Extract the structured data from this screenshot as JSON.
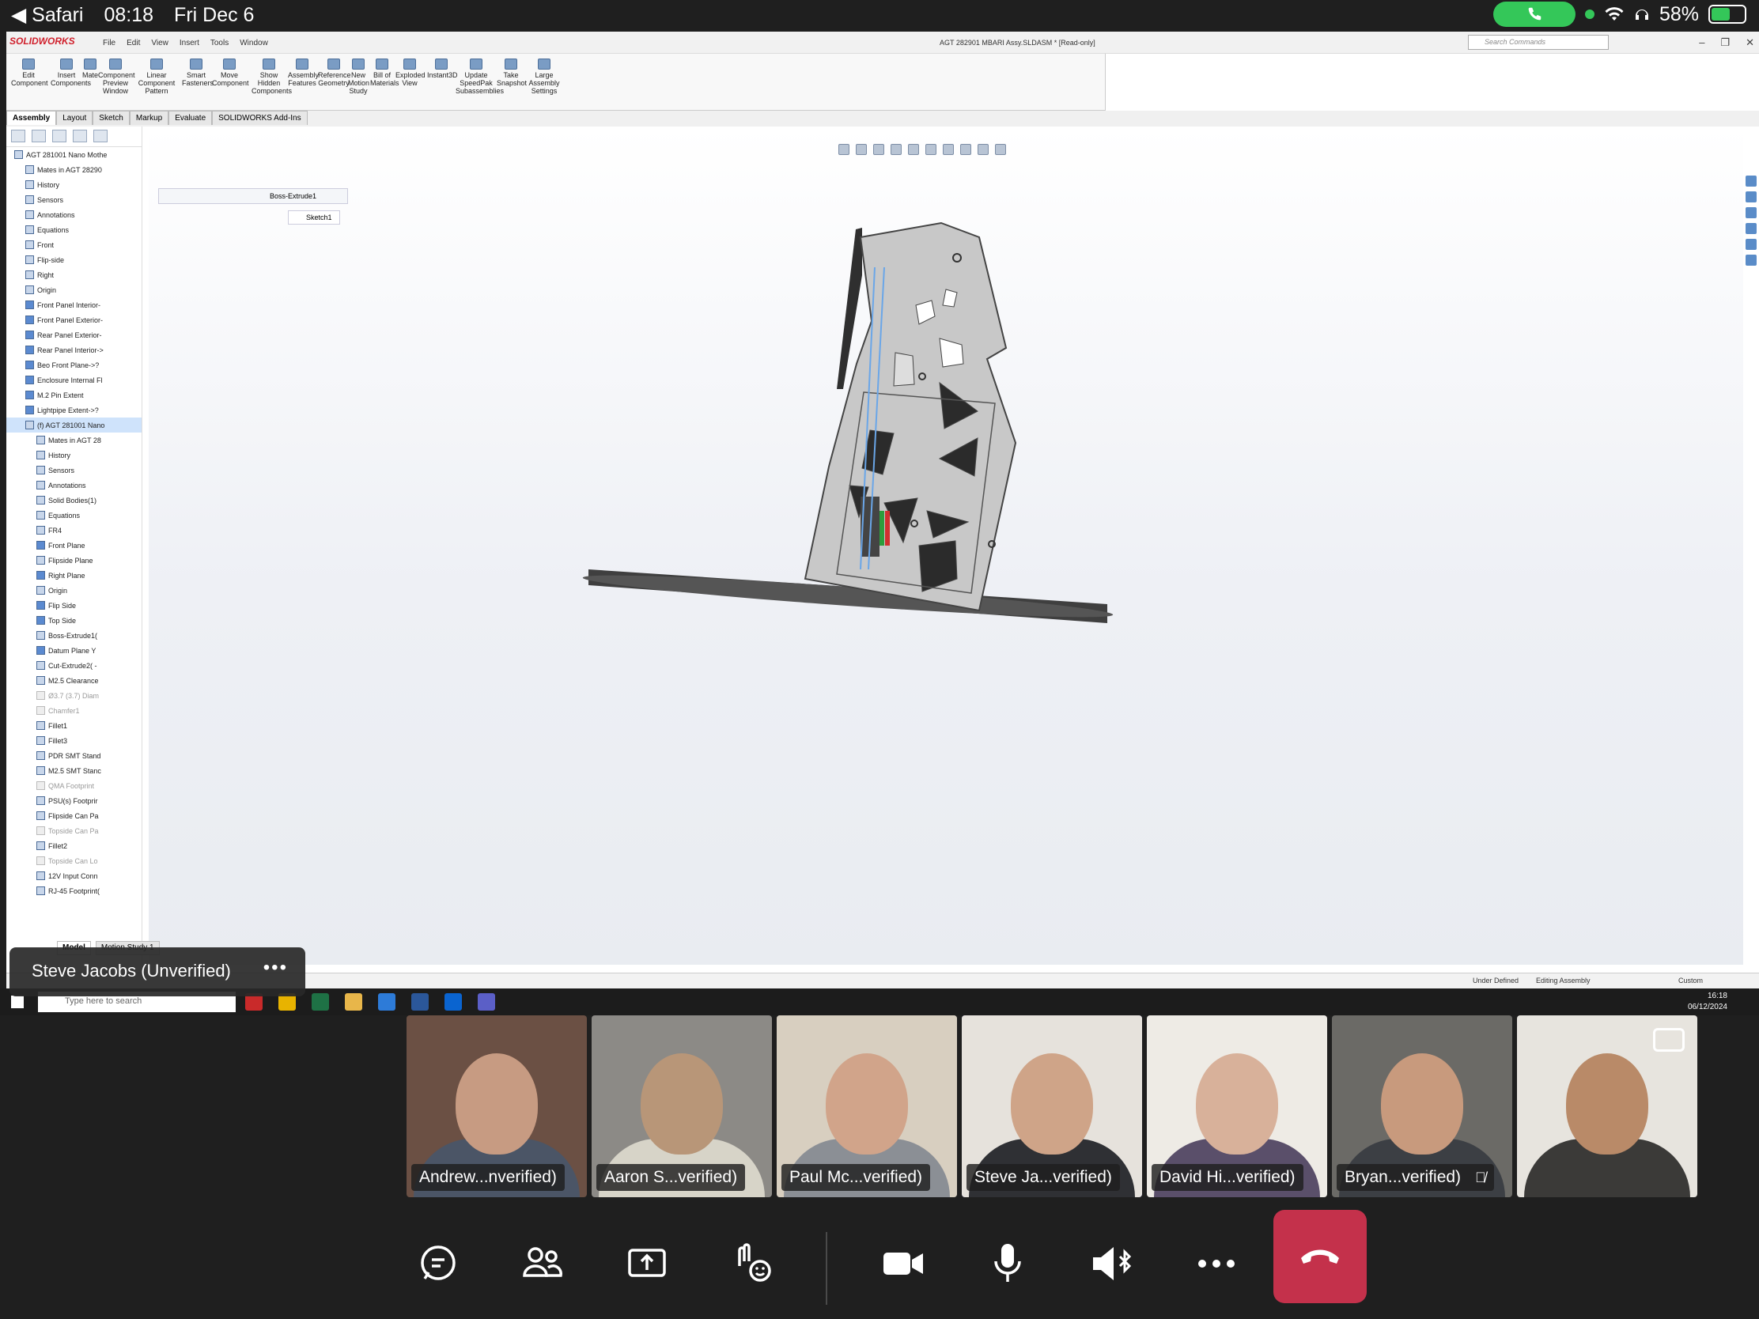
{
  "status_bar": {
    "app": "Safari",
    "time": "08:18",
    "date": "Fri Dec 6",
    "battery": "58%",
    "battery_level": 0.58
  },
  "solidworks": {
    "logo": "SOLIDWORKS",
    "menus": [
      "File",
      "Edit",
      "View",
      "Insert",
      "Tools",
      "Window"
    ],
    "doc_title": "AGT 282901 MBARI Assy.SLDASM * [Read-only]",
    "search_placeholder": "Search Commands",
    "ribbon": [
      "Edit Component",
      "Insert Components",
      "Mate",
      "Component Preview Window",
      "Linear Component Pattern",
      "Smart Fasteners",
      "Move Component",
      "Show Hidden Components",
      "Assembly Features",
      "Reference Geometry",
      "New Motion Study",
      "Bill of Materials",
      "Exploded View",
      "Instant3D",
      "Update SpeedPak Subassemblies",
      "Take Snapshot",
      "Large Assembly Settings"
    ],
    "tabs": [
      "Assembly",
      "Layout",
      "Sketch",
      "Markup",
      "Evaluate",
      "SOLIDWORKS Add-Ins"
    ],
    "breadcrumb": "Boss-Extrude1",
    "breadcrumb_sketch": "Sketch1",
    "tree": [
      {
        "label": "AGT 281001 Nano Mothe",
        "kind": "asm",
        "indent": 0
      },
      {
        "label": "Mates in AGT 28290",
        "kind": "item",
        "indent": 1
      },
      {
        "label": "History",
        "kind": "item",
        "indent": 1
      },
      {
        "label": "Sensors",
        "kind": "item",
        "indent": 1
      },
      {
        "label": "Annotations",
        "kind": "item",
        "indent": 1
      },
      {
        "label": "Equations",
        "kind": "item",
        "indent": 1
      },
      {
        "label": "Front",
        "kind": "plane0",
        "indent": 1
      },
      {
        "label": "Flip-side",
        "kind": "plane0",
        "indent": 1
      },
      {
        "label": "Right",
        "kind": "plane0",
        "indent": 1
      },
      {
        "label": "Origin",
        "kind": "item",
        "indent": 1
      },
      {
        "label": "Front Panel Interior-",
        "kind": "plane",
        "indent": 1
      },
      {
        "label": "Front Panel Exterior-",
        "kind": "plane",
        "indent": 1
      },
      {
        "label": "Rear Panel Exterior-",
        "kind": "plane",
        "indent": 1
      },
      {
        "label": "Rear Panel Interior->",
        "kind": "plane",
        "indent": 1
      },
      {
        "label": "Beo Front Plane->?",
        "kind": "plane",
        "indent": 1
      },
      {
        "label": "Enclosure Internal Fl",
        "kind": "plane",
        "indent": 1
      },
      {
        "label": "M.2 Pin Extent",
        "kind": "plane",
        "indent": 1
      },
      {
        "label": "Lightpipe Extent->?",
        "kind": "plane",
        "indent": 1
      },
      {
        "label": "(f) AGT 281001 Nano",
        "kind": "sel",
        "indent": 1
      },
      {
        "label": "Mates in AGT 28",
        "kind": "item",
        "indent": 2
      },
      {
        "label": "History",
        "kind": "item",
        "indent": 2
      },
      {
        "label": "Sensors",
        "kind": "item",
        "indent": 2
      },
      {
        "label": "Annotations",
        "kind": "item",
        "indent": 2
      },
      {
        "label": "Solid Bodies(1)",
        "kind": "item",
        "indent": 2
      },
      {
        "label": "Equations",
        "kind": "item",
        "indent": 2
      },
      {
        "label": "FR4",
        "kind": "item",
        "indent": 2
      },
      {
        "label": "Front Plane",
        "kind": "plane",
        "indent": 2
      },
      {
        "label": "Flipside Plane",
        "kind": "plane0",
        "indent": 2
      },
      {
        "label": "Right Plane",
        "kind": "plane",
        "indent": 2
      },
      {
        "label": "Origin",
        "kind": "item",
        "indent": 2
      },
      {
        "label": "Flip Side",
        "kind": "plane",
        "indent": 2
      },
      {
        "label": "Top Side",
        "kind": "plane",
        "indent": 2
      },
      {
        "label": "Boss-Extrude1(",
        "kind": "item",
        "indent": 2
      },
      {
        "label": "Datum Plane Y",
        "kind": "plane",
        "indent": 2
      },
      {
        "label": "Cut-Extrude2( -",
        "kind": "item",
        "indent": 2
      },
      {
        "label": "M2.5 Clearance",
        "kind": "item",
        "indent": 2
      },
      {
        "label": "Ø3.7 (3.7) Diam",
        "kind": "dim",
        "indent": 2
      },
      {
        "label": "Chamfer1",
        "kind": "dim",
        "indent": 2
      },
      {
        "label": "Fillet1",
        "kind": "item",
        "indent": 2
      },
      {
        "label": "Fillet3",
        "kind": "item",
        "indent": 2
      },
      {
        "label": "PDR SMT Stand",
        "kind": "item",
        "indent": 2
      },
      {
        "label": "M2.5 SMT Stanc",
        "kind": "item",
        "indent": 2
      },
      {
        "label": "QMA Footprint",
        "kind": "dim",
        "indent": 2
      },
      {
        "label": "PSU(s) Footprir",
        "kind": "item",
        "indent": 2
      },
      {
        "label": "Flipside Can Pa",
        "kind": "item",
        "indent": 2
      },
      {
        "label": "Topside Can Pa",
        "kind": "dim",
        "indent": 2
      },
      {
        "label": "Fillet2",
        "kind": "item",
        "indent": 2
      },
      {
        "label": "Topside Can Lo",
        "kind": "dim",
        "indent": 2
      },
      {
        "label": "12V Input Conn",
        "kind": "item",
        "indent": 2
      },
      {
        "label": "RJ-45 Footprint(",
        "kind": "item",
        "indent": 2
      }
    ],
    "bottom_tabs": [
      "Model",
      "Motion Study 1"
    ],
    "status": {
      "under_defined": "Under Defined",
      "editing": "Editing Assembly",
      "custom": "Custom"
    }
  },
  "windows": {
    "search_placeholder": "Type here to search",
    "clock_time": "16:18",
    "clock_date": "06/12/2024"
  },
  "presenter_label": "Steve Jacobs (Unverified)",
  "participants": [
    {
      "name": "Andrew...nverified)",
      "bg": "#6b5044",
      "skin": "#c79b82",
      "shirt": "#4b5566",
      "muted": false
    },
    {
      "name": "Aaron S...verified)",
      "bg": "#8c8a86",
      "skin": "#b89678",
      "shirt": "#d7d4c8",
      "muted": false
    },
    {
      "name": "Paul Mc...verified)",
      "bg": "#d8cfc0",
      "skin": "#d1a48a",
      "shirt": "#8b8f95",
      "muted": false
    },
    {
      "name": "Steve Ja...verified)",
      "bg": "#e6e2dc",
      "skin": "#cfa488",
      "shirt": "#2f3034",
      "muted": false
    },
    {
      "name": "David Hi...verified)",
      "bg": "#eeebe5",
      "skin": "#d8b19a",
      "shirt": "#5a4f6a",
      "muted": false
    },
    {
      "name": "Bryan...verified)",
      "bg": "#6b6a66",
      "skin": "#c89a7d",
      "shirt": "#3c3f44",
      "muted": true
    },
    {
      "name": "",
      "bg": "#e7e4de",
      "skin": "#b98a68",
      "shirt": "#3b3a38",
      "muted": false
    }
  ],
  "controls": [
    "chat",
    "participants",
    "share",
    "raise-hand",
    "camera",
    "microphone",
    "speaker",
    "more",
    "leave"
  ]
}
